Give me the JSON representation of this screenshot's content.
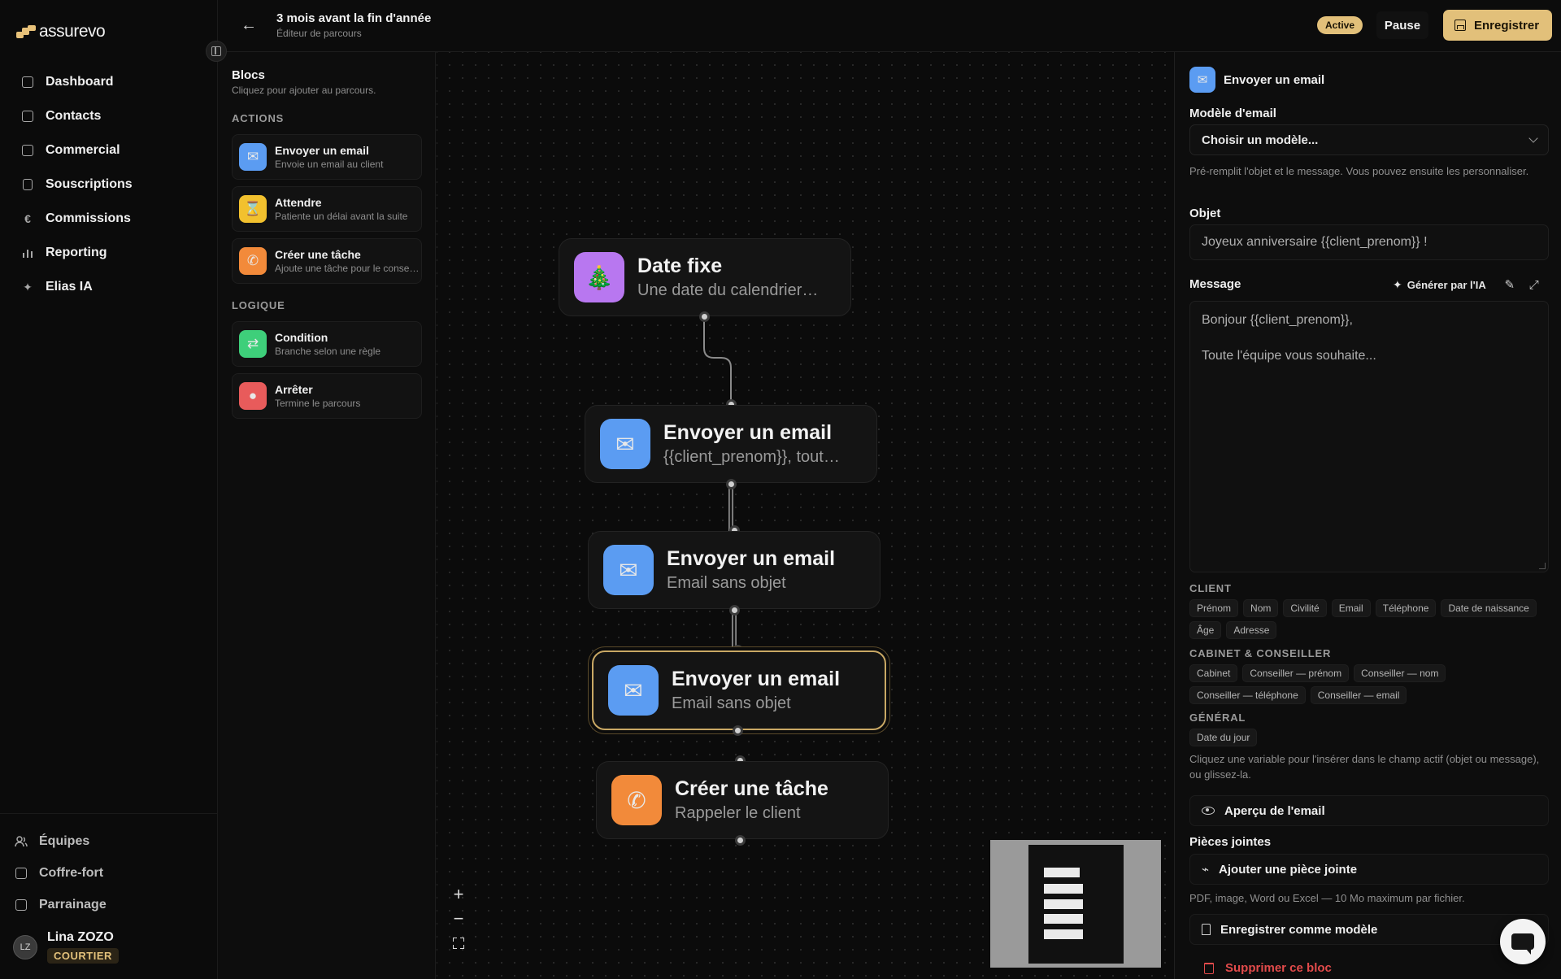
{
  "brand": {
    "name": "assurevo",
    "accent": "#e2c07a"
  },
  "nav": {
    "items": [
      {
        "label": "Dashboard",
        "icon": "dashboard-icon"
      },
      {
        "label": "Contacts",
        "icon": "contacts-icon"
      },
      {
        "label": "Commercial",
        "icon": "commercial-icon"
      },
      {
        "label": "Souscriptions",
        "icon": "document-icon"
      },
      {
        "label": "Commissions",
        "icon": "euro-icon"
      },
      {
        "label": "Reporting",
        "icon": "bar-chart-icon"
      },
      {
        "label": "Elias IA",
        "icon": "sparkles-icon"
      }
    ],
    "bottom": [
      {
        "label": "Équipes",
        "icon": "team-icon"
      },
      {
        "label": "Coffre-fort",
        "icon": "vault-icon"
      },
      {
        "label": "Parrainage",
        "icon": "gift-icon"
      }
    ],
    "user": {
      "initials": "LZ",
      "name": "Lina ZOZO",
      "role": "COURTIER"
    }
  },
  "topbar": {
    "title": "3 mois avant la fin d'année",
    "subtitle": "Éditeur de parcours",
    "status": "Active",
    "pause_label": "Pause",
    "save_label": "Enregistrer"
  },
  "palette": {
    "title": "Blocs",
    "subtitle": "Cliquez pour ajouter au parcours.",
    "sections": [
      {
        "label": "ACTIONS",
        "items": [
          {
            "name": "Envoyer un email",
            "desc": "Envoie un email au client",
            "icon": "envelope-icon",
            "color": "#5b9cf2"
          },
          {
            "name": "Attendre",
            "desc": "Patiente un délai avant la suite",
            "icon": "hourglass-icon",
            "color": "#f2c12e"
          },
          {
            "name": "Créer une tâche",
            "desc": "Ajoute une tâche pour le conseiller",
            "icon": "phone-icon",
            "color": "#f28a3a"
          }
        ]
      },
      {
        "label": "LOGIQUE",
        "items": [
          {
            "name": "Condition",
            "desc": "Branche selon une règle",
            "icon": "condition-icon",
            "color": "#3ecf7a"
          },
          {
            "name": "Arrêter",
            "desc": "Termine le parcours",
            "icon": "stop-icon",
            "color": "#e85b5b"
          }
        ]
      }
    ]
  },
  "flow": {
    "nodes": [
      {
        "title": "Date fixe",
        "subtitle": "Une date du calendrier…",
        "icon": "tree-icon",
        "color": "#b877f0"
      },
      {
        "title": "Envoyer un email",
        "subtitle": "{{client_prenom}}, tout…",
        "icon": "envelope-icon",
        "color": "#5b9cf2"
      },
      {
        "title": "Envoyer un email",
        "subtitle": "Email sans objet",
        "icon": "envelope-icon",
        "color": "#5b9cf2"
      },
      {
        "title": "Envoyer un email",
        "subtitle": "Email sans objet",
        "icon": "envelope-icon",
        "color": "#5b9cf2",
        "selected": true
      },
      {
        "title": "Créer une tâche",
        "subtitle": "Rappeler le client",
        "icon": "phone-icon",
        "color": "#f28a3a"
      }
    ]
  },
  "panel": {
    "header": "Envoyer un email",
    "template_label": "Modèle d'email",
    "template_value": "Choisir un modèle...",
    "template_help": "Pré-remplit l'objet et le message. Vous pouvez ensuite les personnaliser.",
    "subject_label": "Objet",
    "subject_value": "Joyeux anniversaire {{client_prenom}} !",
    "message_label": "Message",
    "generate_label": "Générer par l'IA",
    "message_lines": [
      "Bonjour {{client_prenom}},",
      "Toute l'équipe vous souhaite..."
    ],
    "variables": [
      {
        "section": "CLIENT",
        "chips": [
          "Prénom",
          "Nom",
          "Civilité",
          "Email",
          "Téléphone",
          "Date de naissance",
          "Âge",
          "Adresse"
        ]
      },
      {
        "section": "CABINET & CONSEILLER",
        "chips": [
          "Cabinet",
          "Conseiller — prénom",
          "Conseiller — nom",
          "Conseiller — téléphone",
          "Conseiller — email"
        ]
      },
      {
        "section": "GÉNÉRAL",
        "chips": [
          "Date du jour"
        ]
      }
    ],
    "variables_help": "Cliquez une variable pour l'insérer dans le champ actif (objet ou message), ou glissez-la.",
    "preview_label": "Aperçu de l'email",
    "attachments_label": "Pièces jointes",
    "add_attachment_label": "Ajouter une pièce jointe",
    "attachments_help": "PDF, image, Word ou Excel — 10 Mo maximum par fichier.",
    "save_template_label": "Enregistrer comme modèle",
    "delete_label": "Supprimer ce bloc"
  }
}
